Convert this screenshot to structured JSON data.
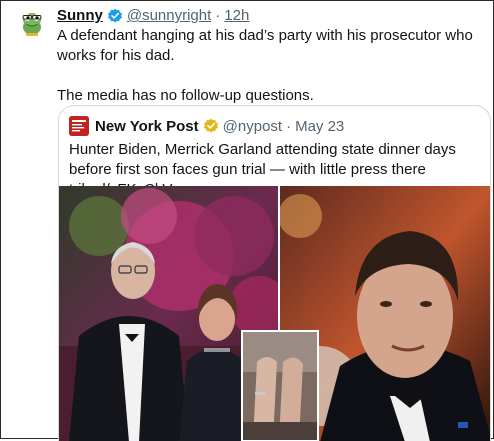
{
  "tweet": {
    "author_name": "Sunny",
    "author_handle": "@sunnyright",
    "separator": "·",
    "time": "12h",
    "text_line1": "A defendant hanging at his dad’s party with his prosecutor who works for his dad.",
    "text_line2": "The media has no follow-up questions.",
    "avatar_icon": "frog-avatar-icon",
    "verified_icon": "verified-badge-icon",
    "verified_color": "#1d9bf0"
  },
  "quoted": {
    "author_name": "New York Post",
    "author_handle": "@nypost",
    "separator": "·",
    "time": "May 23",
    "text": "Hunter Biden, Merrick Garland attending state dinner days before first son faces gun trial — with little press there trib.al/yFKsCkV",
    "logo_icon": "nypost-logo-icon",
    "verified_icon": "gold-verified-badge-icon",
    "verified_color": "#e2b719",
    "brand_color": "#c2251f"
  },
  "media": {
    "left_photo": "photo-garland-couple",
    "right_photo": "photo-hunter-biden",
    "inset_photo": "photo-inset-legs"
  }
}
